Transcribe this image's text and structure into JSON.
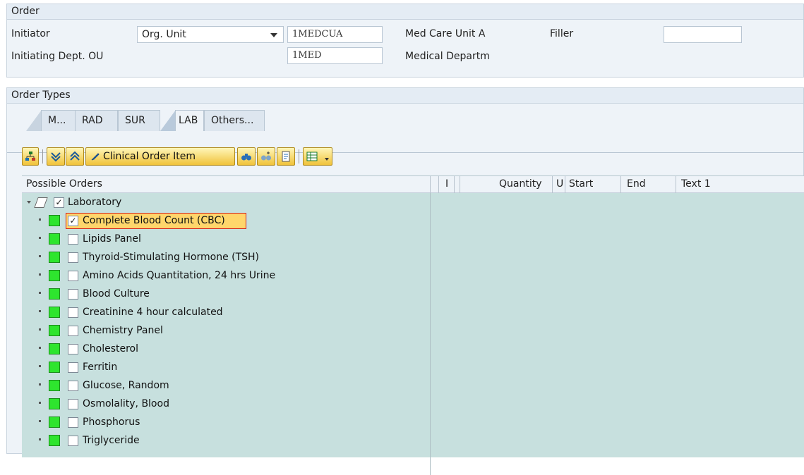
{
  "order": {
    "title": "Order",
    "initiator_label": "Initiator",
    "initiator_select": "Org. Unit",
    "initiator_code": "1MEDCUA",
    "initiator_name": "Med Care Unit A",
    "filler_label": "Filler",
    "filler_value": "",
    "dept_label": "Initiating Dept. OU",
    "dept_code": "1MED",
    "dept_name": "Medical Departm"
  },
  "order_types": {
    "title": "Order Types",
    "tabs": [
      "M...",
      "RAD",
      "SUR",
      "LAB",
      "Others..."
    ],
    "active_tab": "LAB"
  },
  "toolbar": {
    "clinical_order_item_label": "Clinical Order Item"
  },
  "grid": {
    "columns": {
      "possible_orders": "Possible Orders",
      "i": "I",
      "quantity": "Quantity",
      "u": "U",
      "start": "Start",
      "end": "End",
      "text1": "Text 1"
    },
    "root": {
      "label": "Laboratory",
      "checked": true
    },
    "items": [
      {
        "label": "Complete Blood Count (CBC)",
        "checked": true,
        "selected": true
      },
      {
        "label": "Lipids Panel",
        "checked": false
      },
      {
        "label": "Thyroid-Stimulating Hormone (TSH)",
        "checked": false
      },
      {
        "label": "Amino Acids Quantitation, 24 hrs Urine",
        "checked": false
      },
      {
        "label": "Blood Culture",
        "checked": false
      },
      {
        "label": "Creatinine 4 hour calculated",
        "checked": false
      },
      {
        "label": "Chemistry Panel",
        "checked": false
      },
      {
        "label": "Cholesterol",
        "checked": false
      },
      {
        "label": "Ferritin",
        "checked": false
      },
      {
        "label": "Glucose, Random",
        "checked": false
      },
      {
        "label": "Osmolality, Blood",
        "checked": false
      },
      {
        "label": "Phosphorus",
        "checked": false
      },
      {
        "label": "Triglyceride",
        "checked": false
      }
    ]
  },
  "colors": {
    "status_green": "#2ee52e",
    "grid_background": "#c7e0de",
    "selection": "#ffd66b"
  }
}
